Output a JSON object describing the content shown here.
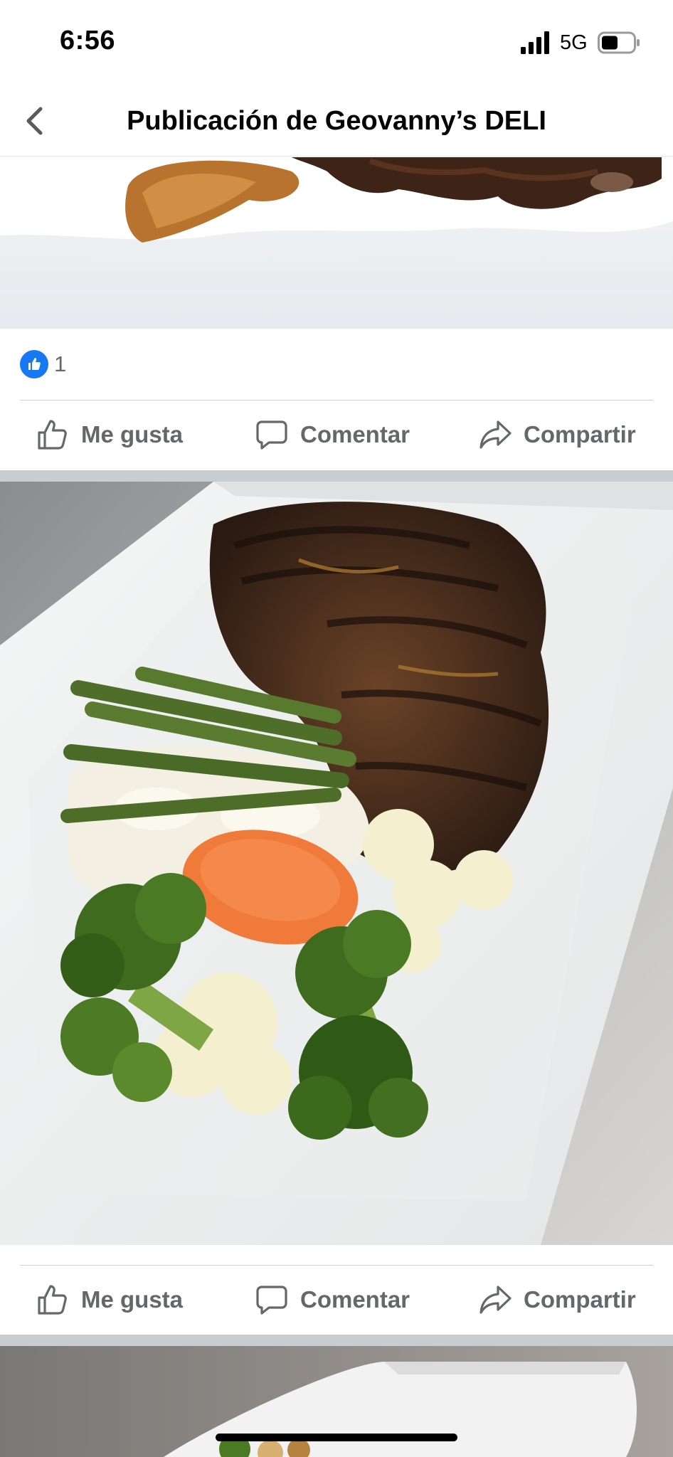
{
  "status_bar": {
    "time": "6:56",
    "network": "5G"
  },
  "nav": {
    "title": "Publicación de Geovanny’s DELI",
    "back_icon": "chevron-left-icon"
  },
  "post_1": {
    "reaction_icon": "like-icon",
    "reaction_count": "1",
    "actions": {
      "like": "Me gusta",
      "comment": "Comentar",
      "share": "Compartir"
    }
  },
  "post_2": {
    "actions": {
      "like": "Me gusta",
      "comment": "Comentar",
      "share": "Compartir"
    }
  },
  "colors": {
    "accent": "#1877f2",
    "action_text": "#65676b",
    "separator": "#c9ccd1"
  }
}
